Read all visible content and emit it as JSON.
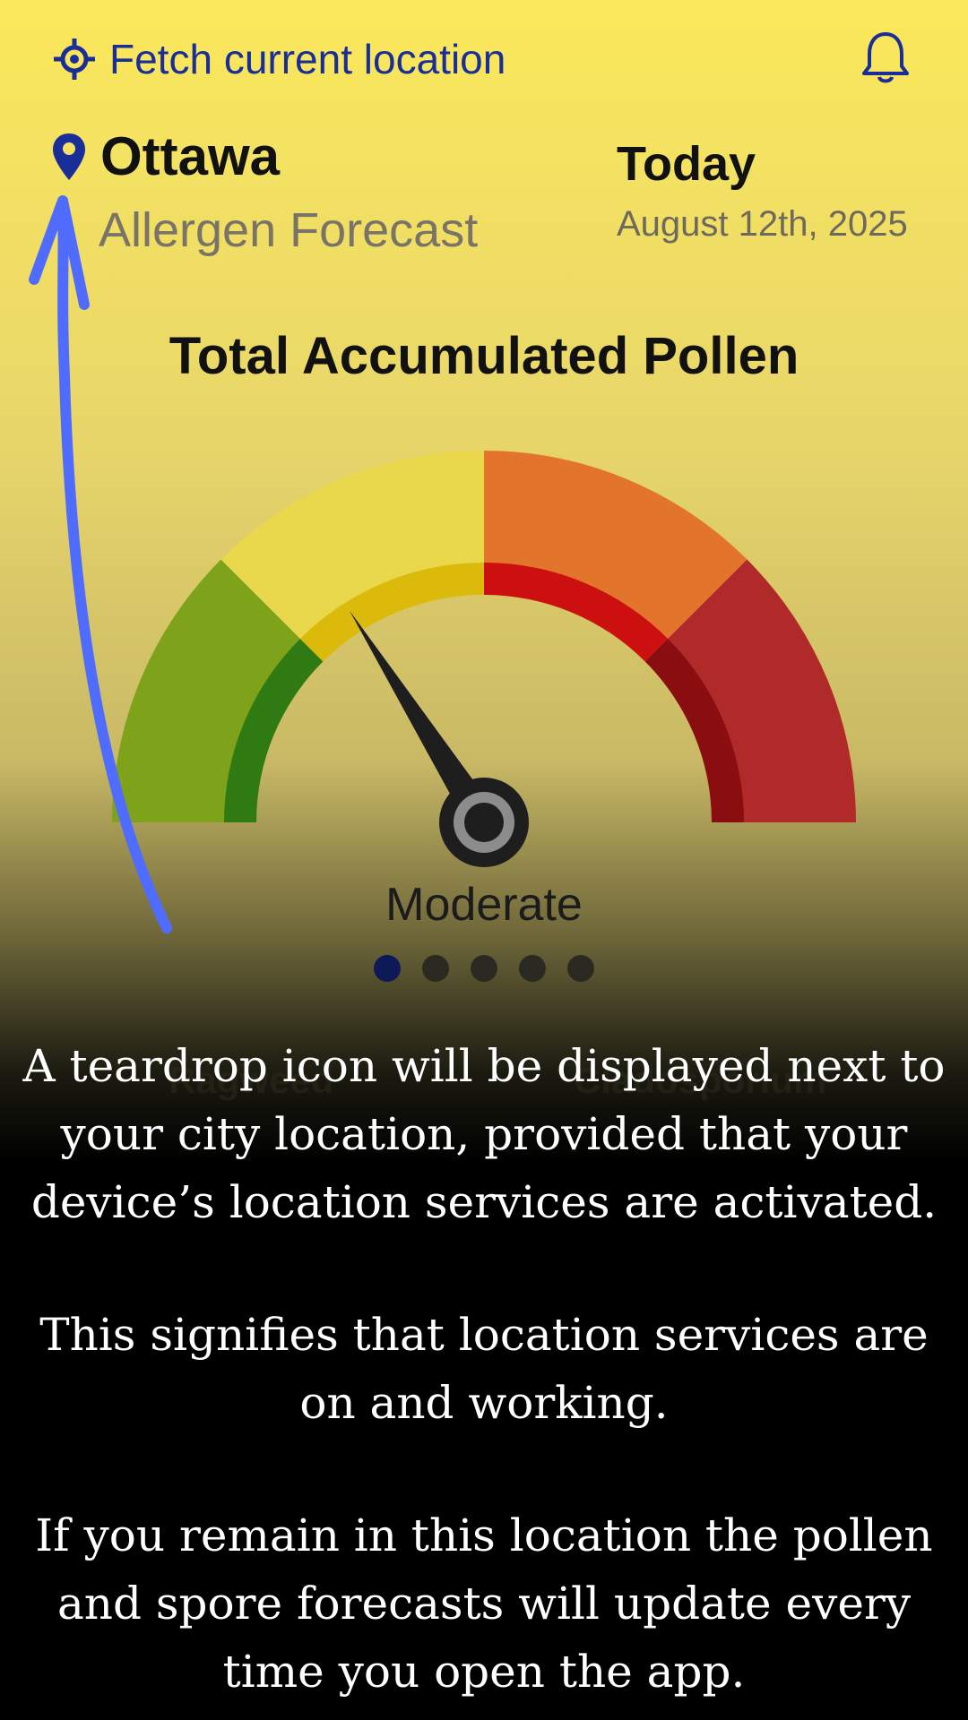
{
  "header": {
    "fetch_location_label": "Fetch current location",
    "fetch_icon": "crosshair-icon",
    "notifications_icon": "bell-icon"
  },
  "location": {
    "city": "Ottawa",
    "pin_icon": "map-pin-icon",
    "subtitle": "Allergen Forecast",
    "day_label": "Today",
    "date": "August 12th, 2025"
  },
  "gauge": {
    "title": "Total Accumulated Pollen",
    "level_label": "Moderate",
    "needle_fraction": 0.32,
    "page_count": 5,
    "active_page": 1,
    "faint_labels": [
      "Ragweed",
      "Cladosporium"
    ],
    "colors": {
      "low": "#7fa21b",
      "moderate": "#e9d84c",
      "high": "#e2752b",
      "very_high": "#b12a2a"
    }
  },
  "tutorial": {
    "paragraph_1": "A teardrop icon will be displayed next to your city location, provided that your device’s location services are activated.",
    "paragraph_2": "This signifies that location services are on and working.",
    "paragraph_3": "If you remain in this location the pollen and spore forecasts will update every time you open the app.",
    "arrow_color": "#4f6cff"
  }
}
